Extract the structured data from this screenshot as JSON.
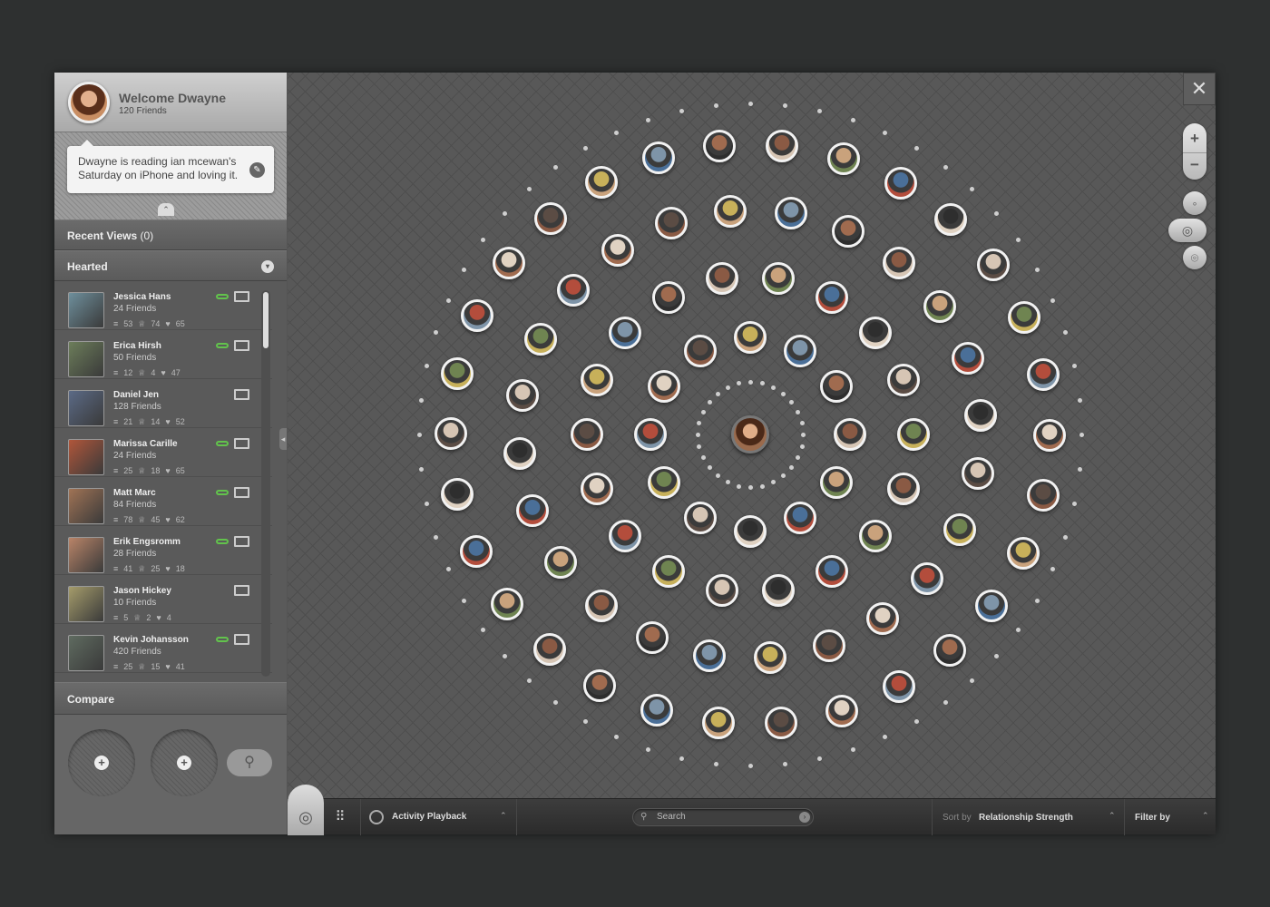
{
  "profile": {
    "welcome": "Welcome Dwayne",
    "friends": "120 Friends",
    "status": "Dwayne is reading ian mcewan's Saturday on iPhone and loving it."
  },
  "recent": {
    "label": "Recent Views",
    "count": "(0)"
  },
  "hearted": {
    "label": "Hearted",
    "items": [
      {
        "name": "Jessica Hans",
        "friends": "24 Friends",
        "s1": "53",
        "s2": "74",
        "s3": "65",
        "online": true,
        "color": "#6e8f9c"
      },
      {
        "name": "Erica Hirsh",
        "friends": "50 Friends",
        "s1": "12",
        "s2": "4",
        "s3": "47",
        "online": true,
        "color": "#6c7d5a"
      },
      {
        "name": "Daniel Jen",
        "friends": "128 Friends",
        "s1": "21",
        "s2": "14",
        "s3": "52",
        "online": false,
        "color": "#5b6a86"
      },
      {
        "name": "Marissa Carille",
        "friends": "24 Friends",
        "s1": "25",
        "s2": "18",
        "s3": "65",
        "online": true,
        "color": "#b0563a"
      },
      {
        "name": "Matt Marc",
        "friends": "84 Friends",
        "s1": "78",
        "s2": "45",
        "s3": "62",
        "online": true,
        "color": "#a07355"
      },
      {
        "name": "Erik Engsromm",
        "friends": "28 Friends",
        "s1": "41",
        "s2": "25",
        "s3": "18",
        "online": true,
        "color": "#b98468"
      },
      {
        "name": "Jason Hickey",
        "friends": "10 Friends",
        "s1": "5",
        "s2": "2",
        "s3": "4",
        "online": false,
        "color": "#a59c6b"
      },
      {
        "name": "Kevin Johansson",
        "friends": "420 Friends",
        "s1": "25",
        "s2": "15",
        "s3": "41",
        "online": true,
        "color": "#5f6b60"
      }
    ]
  },
  "compare": {
    "label": "Compare"
  },
  "bottom": {
    "playback": "Activity Playback",
    "search_placeholder": "Search",
    "sort_prefix": "Sort by",
    "sort_value": "Relationship Strength",
    "filter": "Filter by"
  },
  "icons": {
    "close": "close-icon",
    "zoom_in": "plus-icon",
    "zoom_out": "minus-icon",
    "home": "target-icon",
    "grid": "grid-icon",
    "search": "search-icon"
  },
  "colors": {
    "online": "#62c34c",
    "background": "#2e3030",
    "panel": "#5f5f5f"
  },
  "friend_palette": [
    "#8a5a44",
    "#c9a27c",
    "#4a6f98",
    "#2e2e2e",
    "#d6c5b4",
    "#6f8451",
    "#b34d3c",
    "#e0d2c2",
    "#5b4c44",
    "#c7b05a",
    "#7e94a8",
    "#a06b4f"
  ]
}
